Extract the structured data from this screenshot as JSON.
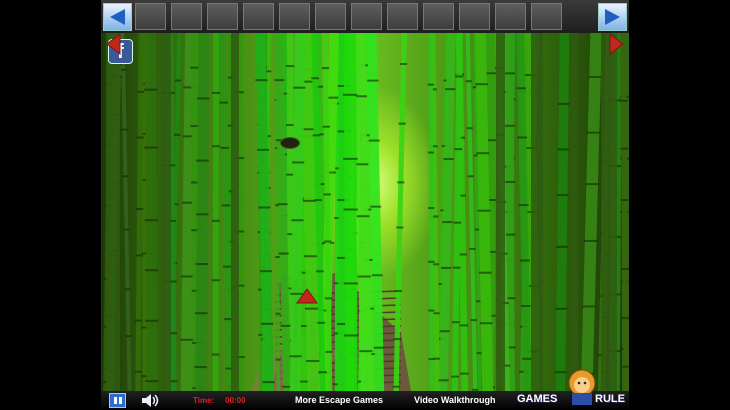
{
  "inventory": {
    "slot_count": 12
  },
  "social": {
    "label": "f"
  },
  "bottom_bar": {
    "time_label": "Time:",
    "time_value": "00:00",
    "more_games": "More Escape Games",
    "walkthrough": "Video Walkthrough",
    "logo_left": "GAMES",
    "logo_right": "RULE"
  },
  "icons": {
    "prev": "left-arrow-icon",
    "next": "right-arrow-icon",
    "pause": "pause-icon",
    "sound": "speaker-icon",
    "facebook": "facebook-icon",
    "scene_left": "scene-left-arrow-icon",
    "scene_right": "scene-right-arrow-icon",
    "scene_forward": "scene-forward-arrow-icon",
    "mascot": "lion-mascot-icon"
  },
  "colors": {
    "nav_arrow": "#1f5fbf",
    "scene_arrow": "#c0281e",
    "time_text": "#e02020"
  }
}
